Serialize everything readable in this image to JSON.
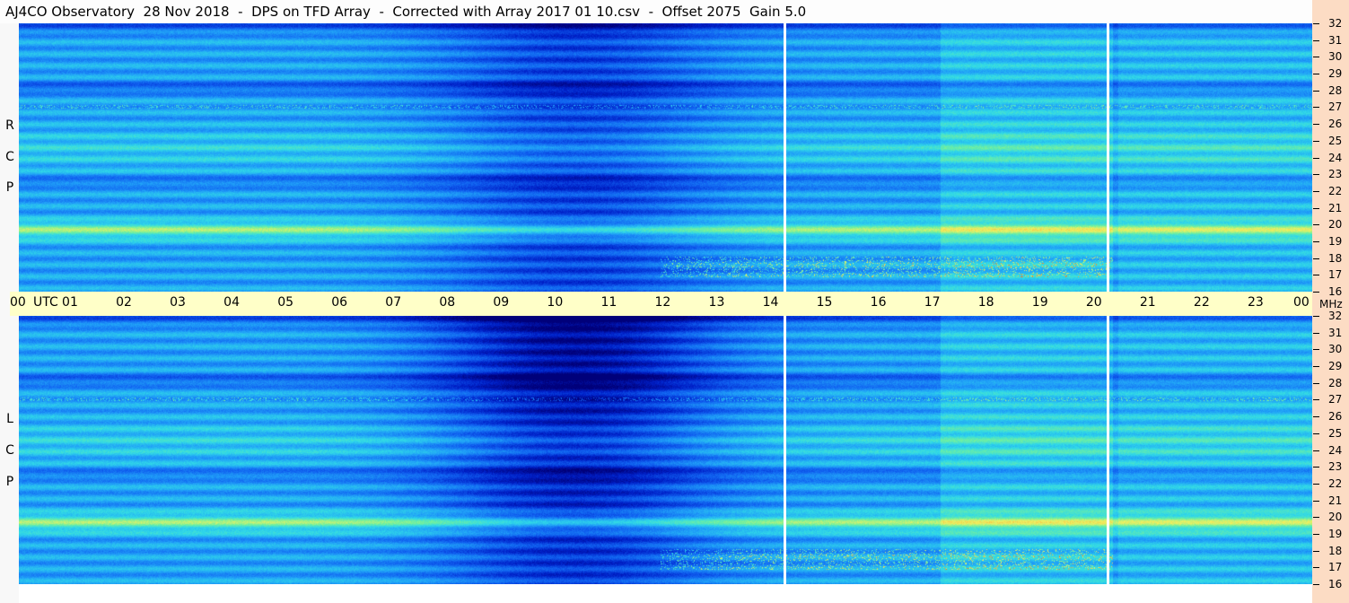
{
  "title": "AJ4CO Observatory  28 Nov 2018  -  DPS on TFD Array  -  Corrected with Array 2017 01 10.csv  -  Offset 2075  Gain 5.0",
  "time_axis": {
    "labels": [
      "00",
      "01",
      "02",
      "03",
      "04",
      "05",
      "06",
      "07",
      "08",
      "09",
      "10",
      "11",
      "12",
      "13",
      "14",
      "15",
      "16",
      "17",
      "18",
      "19",
      "20",
      "21",
      "22",
      "23",
      "00"
    ],
    "utc_label": "UTC",
    "mhz_label": "MHz"
  },
  "panels": [
    {
      "id": "rcp",
      "label_letters": [
        "R",
        "C",
        "P"
      ]
    },
    {
      "id": "lcp",
      "label_letters": [
        "L",
        "C",
        "P"
      ]
    }
  ],
  "colors": {
    "axis_background": "#ffffc8",
    "right_axis_background": "#fcdcc4",
    "gap_line": "#ffffff"
  },
  "chart_data": {
    "type": "heatmap",
    "title": "AJ4CO Observatory  28 Nov 2018  -  DPS on TFD Array  -  Corrected with Array 2017 01 10.csv  -  Offset 2075  Gain 5.0",
    "x": {
      "unit": "UTC hours",
      "range": [
        0,
        24
      ],
      "ticks": [
        "00",
        "01",
        "02",
        "03",
        "04",
        "05",
        "06",
        "07",
        "08",
        "09",
        "10",
        "11",
        "12",
        "13",
        "14",
        "15",
        "16",
        "17",
        "18",
        "19",
        "20",
        "21",
        "22",
        "23",
        "00"
      ]
    },
    "y": {
      "unit": "MHz",
      "range": [
        16,
        32
      ],
      "ticks": [
        16,
        17,
        18,
        19,
        20,
        21,
        22,
        23,
        24,
        25,
        26,
        27,
        28,
        29,
        30,
        31,
        32
      ]
    },
    "panels": [
      "RCP",
      "LCP"
    ],
    "data_gaps_utc": [
      14.25,
      20.3
    ],
    "colormap": [
      "#00007a",
      "#0020c8",
      "#1060f0",
      "#20a0f8",
      "#30d8e8",
      "#70f0a0",
      "#f0f060",
      "#f09030",
      "#e02020",
      "#ffffff"
    ]
  }
}
